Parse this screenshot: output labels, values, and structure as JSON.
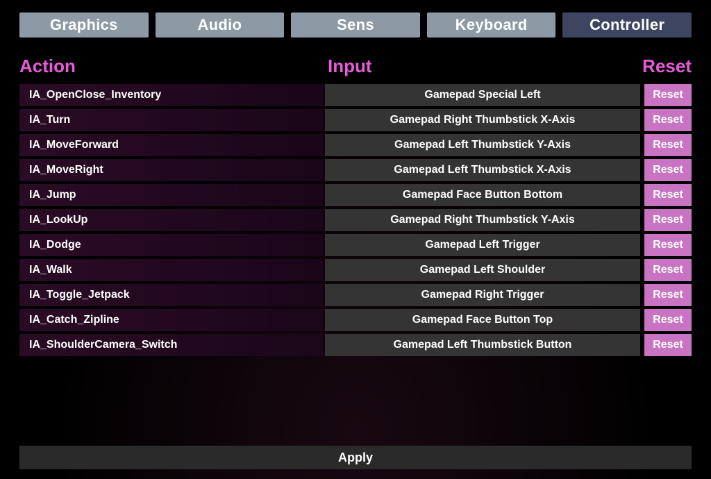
{
  "tabs": [
    {
      "label": "Graphics",
      "active": false
    },
    {
      "label": "Audio",
      "active": false
    },
    {
      "label": "Sens",
      "active": false
    },
    {
      "label": "Keyboard",
      "active": false
    },
    {
      "label": "Controller",
      "active": true
    }
  ],
  "headers": {
    "action": "Action",
    "input": "Input",
    "reset": "Reset"
  },
  "reset_button_label": "Reset",
  "bindings": [
    {
      "action": "IA_OpenClose_Inventory",
      "input": "Gamepad Special Left"
    },
    {
      "action": "IA_Turn",
      "input": "Gamepad Right Thumbstick X-Axis"
    },
    {
      "action": "IA_MoveForward",
      "input": "Gamepad Left Thumbstick Y-Axis"
    },
    {
      "action": "IA_MoveRight",
      "input": "Gamepad Left Thumbstick X-Axis"
    },
    {
      "action": "IA_Jump",
      "input": "Gamepad Face Button Bottom"
    },
    {
      "action": "IA_LookUp",
      "input": "Gamepad Right Thumbstick Y-Axis"
    },
    {
      "action": "IA_Dodge",
      "input": "Gamepad Left Trigger"
    },
    {
      "action": "IA_Walk",
      "input": "Gamepad Left Shoulder"
    },
    {
      "action": "IA_Toggle_Jetpack",
      "input": "Gamepad Right Trigger"
    },
    {
      "action": "IA_Catch_Zipline",
      "input": "Gamepad Face Button Top"
    },
    {
      "action": "IA_ShoulderCamera_Switch",
      "input": "Gamepad Left Thumbstick Button"
    }
  ],
  "apply_label": "Apply",
  "colors": {
    "accent_pink": "#e85bd9",
    "button_pink": "#c874c2",
    "tab_inactive": "#8e99a6",
    "tab_active": "#3e4560",
    "row_input_bg": "#343434",
    "row_action_bg": "#2a0c26"
  }
}
